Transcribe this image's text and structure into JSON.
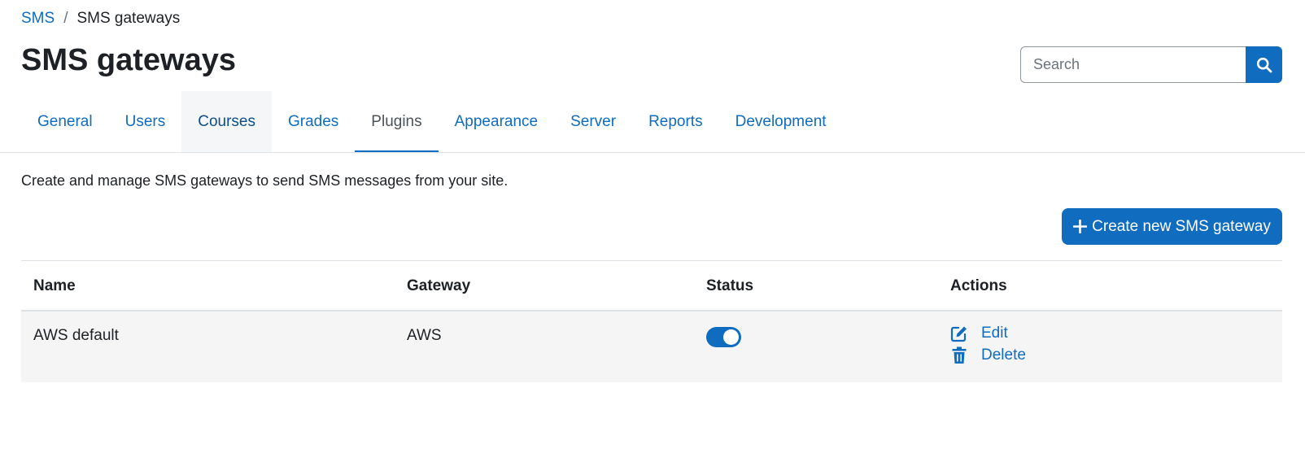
{
  "breadcrumb": {
    "parent": "SMS",
    "separator": "/",
    "current": "SMS gateways"
  },
  "page": {
    "title": "SMS gateways",
    "intro": "Create and manage SMS gateways to send SMS messages from your site."
  },
  "search": {
    "placeholder": "Search",
    "icon": "search-icon"
  },
  "tabs": [
    {
      "label": "General"
    },
    {
      "label": "Users"
    },
    {
      "label": "Courses",
      "state": "hover"
    },
    {
      "label": "Grades"
    },
    {
      "label": "Plugins",
      "state": "active"
    },
    {
      "label": "Appearance"
    },
    {
      "label": "Server"
    },
    {
      "label": "Reports"
    },
    {
      "label": "Development"
    }
  ],
  "create_button": {
    "icon": "plus",
    "label": "Create new SMS gateway"
  },
  "table": {
    "headers": {
      "name": "Name",
      "gateway": "Gateway",
      "status": "Status",
      "actions": "Actions"
    },
    "rows": [
      {
        "name": "AWS default",
        "gateway": "AWS",
        "status_enabled": true,
        "actions": {
          "edit": "Edit",
          "delete": "Delete"
        }
      }
    ]
  },
  "colors": {
    "primary": "#0f6cbf",
    "text": "#1d2125",
    "row_bg": "#f5f5f5",
    "border": "#dee2e6"
  }
}
